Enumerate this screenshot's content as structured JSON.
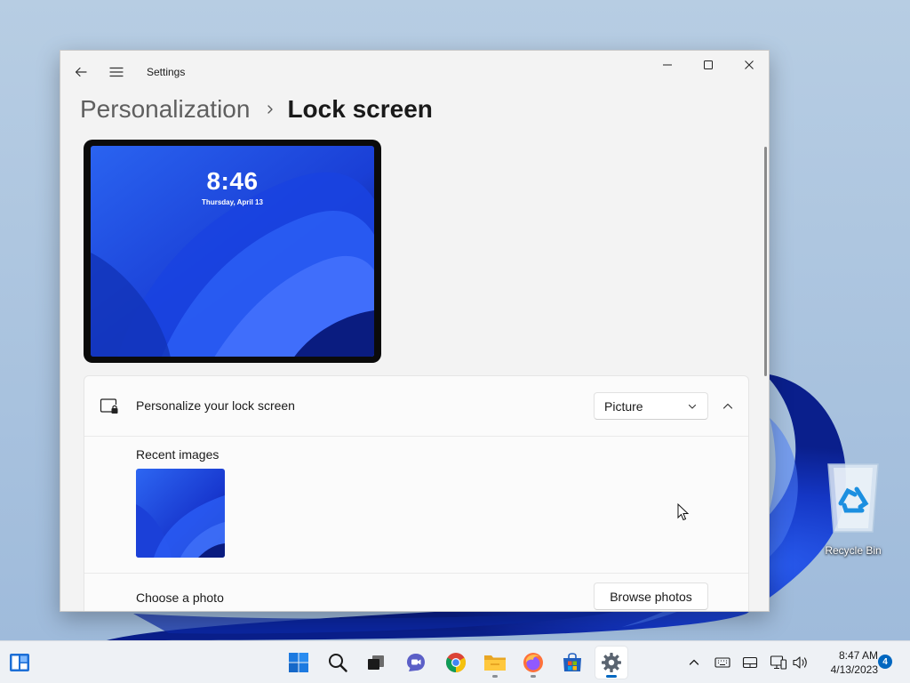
{
  "window": {
    "app_title": "Settings",
    "breadcrumb_parent": "Personalization",
    "breadcrumb_current": "Lock screen"
  },
  "preview": {
    "time": "8:46",
    "date": "Thursday, April 13"
  },
  "lock_card": {
    "title": "Personalize your lock screen",
    "dropdown_value": "Picture",
    "recent_images_label": "Recent images",
    "choose_photo_label": "Choose a photo",
    "browse_button": "Browse photos"
  },
  "desktop": {
    "recycle_bin_label": "Recycle Bin"
  },
  "taskbar": {
    "pinned": [
      "widgets",
      "start",
      "search",
      "task-view",
      "chat",
      "chrome",
      "file-explorer",
      "firefox",
      "store",
      "settings"
    ],
    "clock_time": "8:47 AM",
    "clock_date": "4/13/2023",
    "notification_count": "4"
  },
  "colors": {
    "accent": "#0067c0",
    "wallpaper_blue": "#1a3fd6"
  }
}
